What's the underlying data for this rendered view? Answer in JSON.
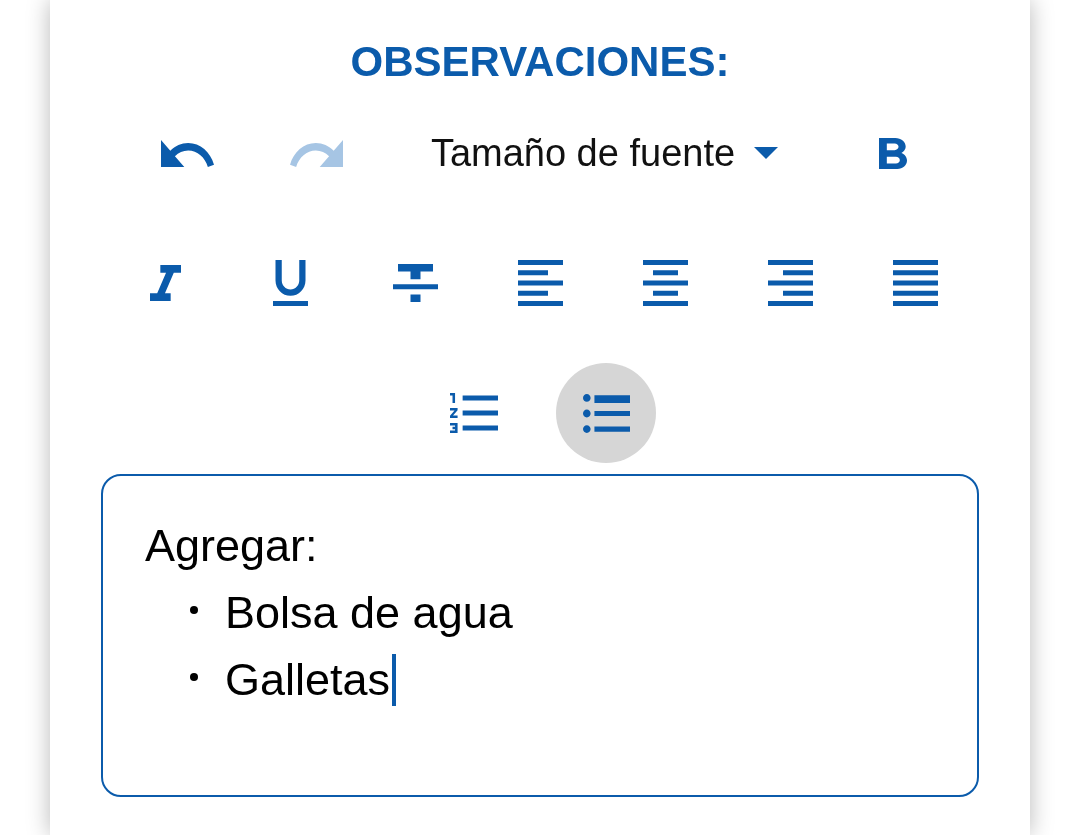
{
  "title": "OBSERVACIONES:",
  "toolbar_rows": [
    [
      {
        "kind": "undo",
        "disabled": false,
        "selected": false
      },
      {
        "kind": "redo",
        "disabled": true,
        "selected": false
      },
      {
        "kind": "font_size",
        "label": "Tamaño de fuente",
        "disabled": false,
        "selected": false
      },
      {
        "kind": "bold",
        "disabled": false,
        "selected": false
      }
    ],
    [
      {
        "kind": "italic",
        "disabled": false,
        "selected": false
      },
      {
        "kind": "underline",
        "disabled": false,
        "selected": false
      },
      {
        "kind": "strikethrough",
        "disabled": false,
        "selected": false
      },
      {
        "kind": "align_left",
        "disabled": false,
        "selected": false
      },
      {
        "kind": "align_center",
        "disabled": false,
        "selected": false
      },
      {
        "kind": "align_right",
        "disabled": false,
        "selected": false
      },
      {
        "kind": "align_justify",
        "disabled": false,
        "selected": false
      }
    ],
    [
      {
        "kind": "numbered_list",
        "disabled": false,
        "selected": false
      },
      {
        "kind": "bulleted_list",
        "disabled": false,
        "selected": true
      }
    ]
  ],
  "editor": {
    "text": "Agregar:",
    "bullets": [
      {
        "text": "Bolsa de agua"
      },
      {
        "text": "Galletas"
      }
    ],
    "caret_after_last": true
  }
}
